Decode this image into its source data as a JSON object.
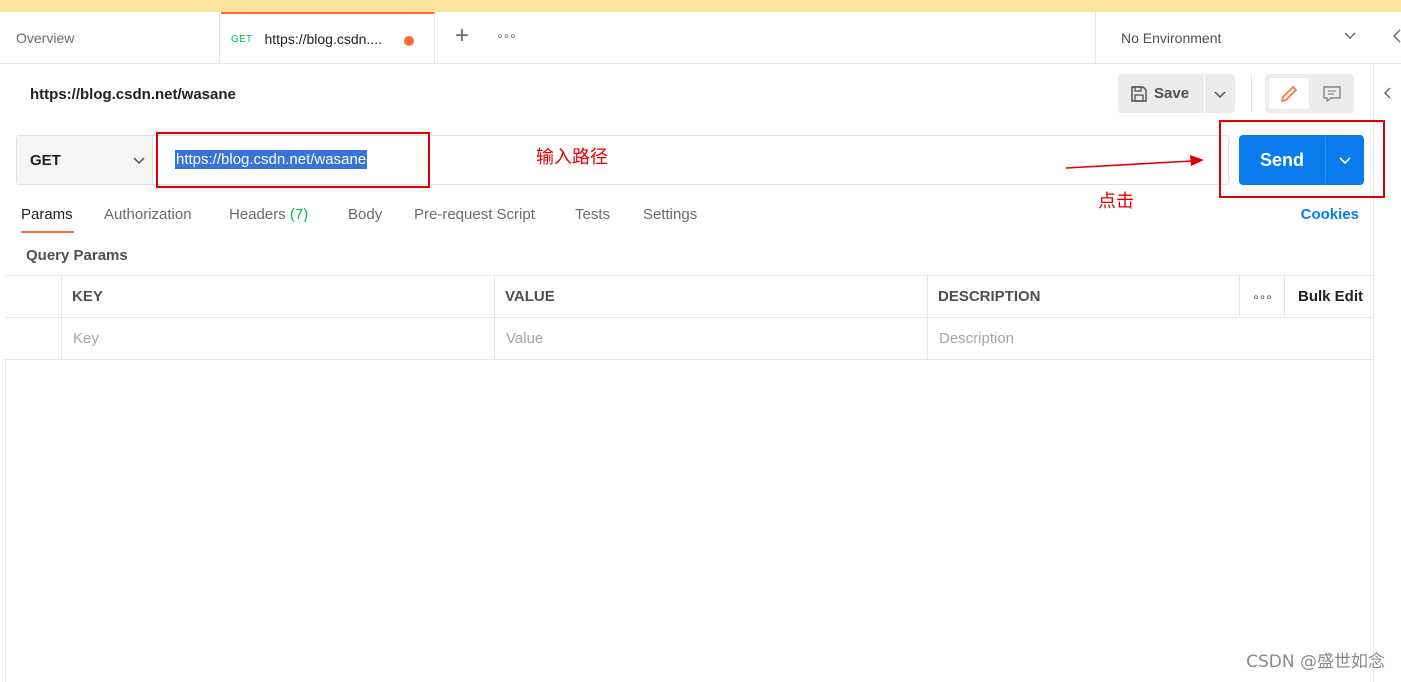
{
  "tabs": {
    "overview_label": "Overview",
    "active_method": "GET",
    "active_title": "https://blog.csdn....",
    "add_icon": "plus-icon",
    "more_icon": "ellipsis-icon"
  },
  "environment": {
    "selected": "No Environment"
  },
  "request": {
    "title": "https://blog.csdn.net/wasane",
    "save_label": "Save",
    "method": "GET",
    "url": "https://blog.csdn.net/wasane",
    "send_label": "Send"
  },
  "annotations": {
    "input_path": "输入路径",
    "click": "点击"
  },
  "subtabs": {
    "params": "Params",
    "authorization": "Authorization",
    "headers": "Headers",
    "headers_count": "(7)",
    "body": "Body",
    "prerequest": "Pre-request Script",
    "tests": "Tests",
    "settings": "Settings",
    "cookies": "Cookies"
  },
  "query_params": {
    "label": "Query Params",
    "columns": {
      "key": "KEY",
      "value": "VALUE",
      "description": "DESCRIPTION"
    },
    "bulk_edit": "Bulk Edit",
    "placeholders": {
      "key": "Key",
      "value": "Value",
      "description": "Description"
    }
  },
  "watermark": "CSDN @盛世如念",
  "colors": {
    "accent": "#ff6c37",
    "primary": "#097bed",
    "get_method": "#0cbb52",
    "annotation": "#e00000",
    "banner": "#fce49e"
  }
}
